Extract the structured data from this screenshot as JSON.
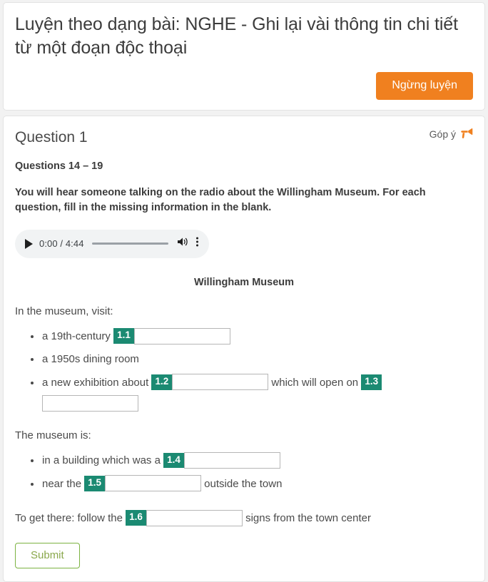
{
  "header": {
    "title": "Luyện theo dạng bài: NGHE - Ghi lại vài thông tin chi tiết từ một đoạn độc thoại",
    "stop_button_label": "Ngừng luyện",
    "stop_button_color": "#f0801f"
  },
  "question": {
    "title": "Question 1",
    "feedback_label": "Góp ý",
    "feedback_icon": "megaphone-icon",
    "feedback_icon_color": "#f0801f",
    "questions_range": "Questions 14 – 19",
    "instructions": "You will hear someone talking on the radio about the Willingham Museum. For each question, fill in the missing information in the blank."
  },
  "audio": {
    "play_icon": "play-icon",
    "time_display": "0:00 / 4:44",
    "current_time": "0:00",
    "duration": "4:44",
    "volume_icon": "volume-icon",
    "more_icon": "more-options-icon"
  },
  "passage": {
    "title": "Willingham Museum",
    "intro_line": "In the museum, visit:",
    "bullets_visit": [
      {
        "text_before": "a 19th-century",
        "badge": "1.1",
        "input_value": "",
        "text_after": ""
      },
      {
        "text_before": "a 1950s dining room",
        "badge": "",
        "input_value": "",
        "text_after": ""
      },
      {
        "text_before": "a new exhibition about",
        "badge": "1.2",
        "input_value": "",
        "text_middle": "which will open on",
        "badge2": "1.3",
        "input_value2": "",
        "text_after": ""
      }
    ],
    "museum_line": "The museum is:",
    "bullets_museum": [
      {
        "text_before": "in a building which was a",
        "badge": "1.4",
        "input_value": "",
        "text_after": ""
      },
      {
        "text_before": "near the",
        "badge": "1.5",
        "input_value": "",
        "text_after": "outside the town"
      }
    ],
    "final_line_before": "To get there: follow the",
    "final_badge": "1.6",
    "final_input_value": "",
    "final_line_after": "signs from the town center"
  },
  "footer": {
    "submit_label": "Submit",
    "submit_color": "#7cb342"
  },
  "theme": {
    "badge_color": "#1b8a72",
    "page_background": "#f2f2f2",
    "card_background": "#ffffff"
  }
}
